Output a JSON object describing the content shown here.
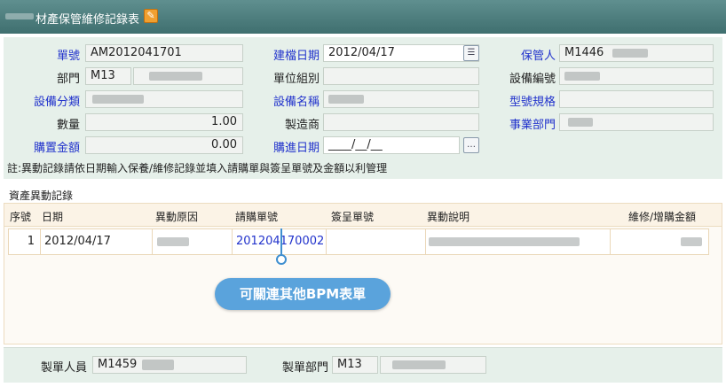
{
  "window": {
    "title": "材產保管維修記錄表"
  },
  "form": {
    "doc_no": {
      "label": "單號",
      "value": "AM2012041701"
    },
    "create_date": {
      "label": "建檔日期",
      "value": "2012/04/17"
    },
    "custodian": {
      "label": "保管人",
      "value": "M1446"
    },
    "dept": {
      "label": "部門",
      "value": "M13"
    },
    "unit_group": {
      "label": "單位組別",
      "value": ""
    },
    "equip_no": {
      "label": "設備編號",
      "value": ""
    },
    "equip_category": {
      "label": "設備分類",
      "value": ""
    },
    "equip_name": {
      "label": "設備名稱",
      "value": ""
    },
    "model_spec": {
      "label": "型號規格",
      "value": ""
    },
    "quantity": {
      "label": "數量",
      "value": "1.00"
    },
    "manufacturer": {
      "label": "製造商",
      "value": ""
    },
    "business_dept": {
      "label": "事業部門",
      "value": ""
    },
    "purchase_amount": {
      "label": "購置金額",
      "value": "0.00"
    },
    "purchase_date": {
      "label": "購進日期",
      "value": "____/__/__"
    }
  },
  "note": "註:異動記錄請依日期輸入保養/維修記錄並填入請購單與簽呈單號及金額以利管理",
  "history": {
    "section_title": "資產異動記錄",
    "columns": [
      "序號",
      "日期",
      "異動原因",
      "請購單號",
      "簽呈單號",
      "異動說明",
      "維修/增購金額"
    ],
    "rows": [
      {
        "seq": "1",
        "date": "2012/04/17",
        "reason": "",
        "pr_no": "201204170002",
        "sign_no": "",
        "desc": "",
        "amount": ""
      }
    ]
  },
  "callout": "可關連其他BPM表單",
  "footer": {
    "maker": {
      "label": "製單人員",
      "value": "M1459"
    },
    "maker_dept": {
      "label": "製單部門",
      "value": "M13"
    }
  },
  "colors": {
    "titlebar": "#4f7f7f",
    "panel": "#e6f0ea",
    "link_label": "#2233cc",
    "callout": "#5aa3dc"
  }
}
